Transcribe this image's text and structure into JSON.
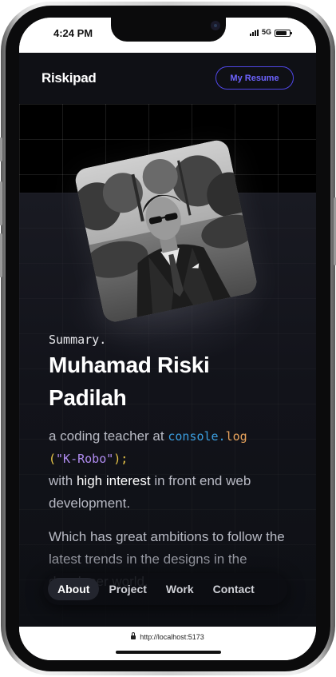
{
  "status_bar": {
    "time": "4:24 PM",
    "network": "5G"
  },
  "header": {
    "brand": "Riskipad",
    "resume_button": "My Resume"
  },
  "profile": {
    "summary_label": "Summary.",
    "name_line1": "Muhamad Riski",
    "name_line2": "Padilah",
    "intro_prefix": "a coding teacher at",
    "code_object": "console.",
    "code_method": "log",
    "code_paren_open": "(",
    "code_string": "\"K-Robo\"",
    "code_paren_close": ");",
    "line_with": "with",
    "line_highlight": "high interest",
    "line_rest": "in front end web development.",
    "para2": "Which has great ambitions to follow the latest trends in the designs in the developer world."
  },
  "nav": {
    "items": [
      {
        "label": "About",
        "active": true
      },
      {
        "label": "Project",
        "active": false
      },
      {
        "label": "Work",
        "active": false
      },
      {
        "label": "Contact",
        "active": false
      }
    ]
  },
  "browser": {
    "url": "http://localhost:5173"
  },
  "colors": {
    "accent": "#4f46e5",
    "code_blue": "#3b9ee0",
    "code_yellow": "#e8c547",
    "code_purple": "#b08cf0"
  }
}
